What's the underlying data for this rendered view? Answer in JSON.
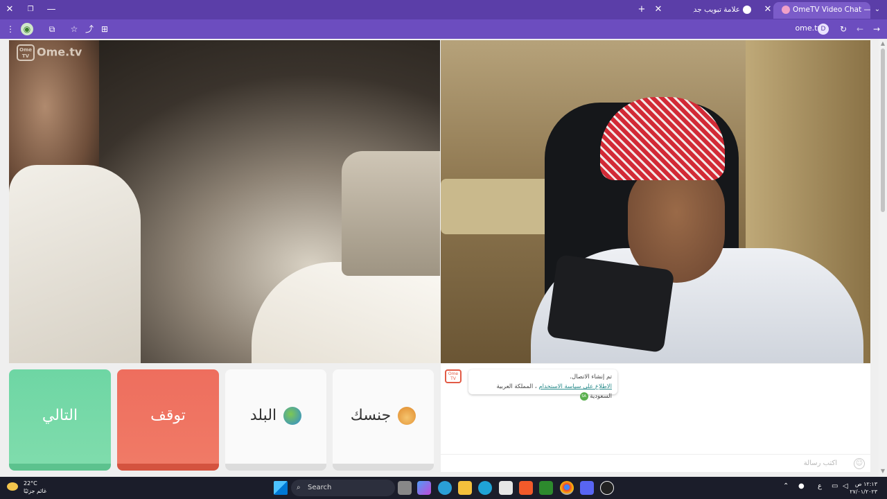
{
  "browser": {
    "tabs": [
      {
        "label": "OmeTV Video Chat — Ome",
        "active": true
      },
      {
        "label": "علامة تبويب جديدة",
        "active": false
      }
    ],
    "url": "ome.tv",
    "profile_initial": "D"
  },
  "site": {
    "logo_text": "Ome.tv",
    "logo_badge": "Ome TV"
  },
  "controls": {
    "next_label": "التالي",
    "stop_label": "توقف",
    "country_label": "البلد",
    "gender_label": "جنسك"
  },
  "chat": {
    "logo_badge": "Ome TV",
    "message_line1": "تم إنشاء الاتصال.",
    "message_link": "الاطلاع على سياسة الاستخدام",
    "message_country": "المملكة العربية السعودية",
    "country_badge": "SA",
    "input_placeholder": "اكتب رسالة"
  },
  "taskbar": {
    "weather_temp": "22°C",
    "weather_desc": "غائم جزئيًا",
    "search_label": "Search",
    "time": "١٢:١٣ ص",
    "date": "٢٧/٠١/٢٠٢٣",
    "input_lang": "ع"
  },
  "colors": {
    "titlebar": "#5b3ea8",
    "next": "#6ed6a4",
    "stop": "#ee6e5e"
  }
}
